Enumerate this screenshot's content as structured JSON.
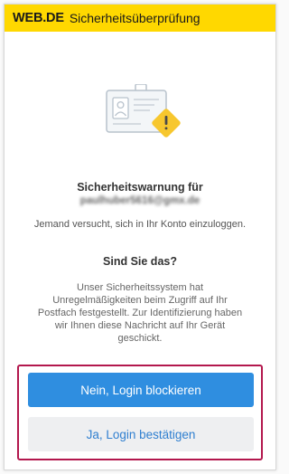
{
  "header": {
    "brand": "WEB.DE",
    "title": "Sicherheitsüberprüfung"
  },
  "warning": {
    "title": "Sicherheitswarnung für",
    "email": "paulhuber5616@gmx.de",
    "attempt_text": "Jemand versucht, sich in Ihr Konto einzuloggen."
  },
  "question": "Sind Sie das?",
  "body_text": "Unser Sicherheitssystem hat Unregelmäßigkeiten beim Zugriff auf Ihr Postfach festgestellt. Zur Identifizierung haben wir Ihnen diese Nachricht auf Ihr Gerät geschickt.",
  "buttons": {
    "block_label": "Nein, Login blockieren",
    "confirm_label": "Ja, Login bestätigen"
  },
  "icons": {
    "id_card": "id-card-icon",
    "warning": "warning-icon"
  },
  "colors": {
    "header_bg": "#ffd800",
    "primary_button": "#2f8ee0",
    "secondary_button_bg": "#eeeff1",
    "highlight_border": "#b3174d",
    "warning_icon": "#f7c72e"
  }
}
